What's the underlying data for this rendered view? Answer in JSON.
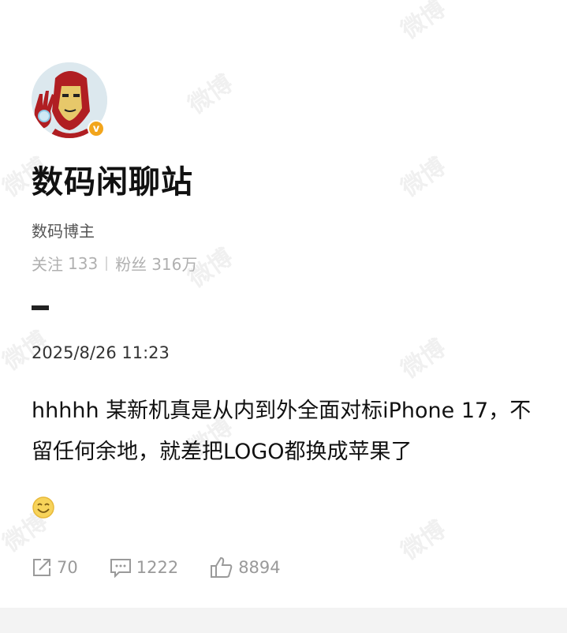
{
  "profile": {
    "name": "数码闲聊站",
    "role": "数码博主",
    "follow_label": "关注",
    "follow_count": "133",
    "fans_label": "粉丝",
    "fans_count": "316万",
    "verified_mark": "v",
    "verified_color": "#f2a51c"
  },
  "post": {
    "time": "2025/8/26 11:23",
    "text": "hhhhh 某新机真是从内到外全面对标iPhone 17，不留任何余地，就差把LOGO都换成苹果了",
    "emoji": "smile-emoji"
  },
  "actions": {
    "repost_count": "70",
    "comment_count": "1222",
    "like_count": "8894"
  },
  "watermark": "微博"
}
